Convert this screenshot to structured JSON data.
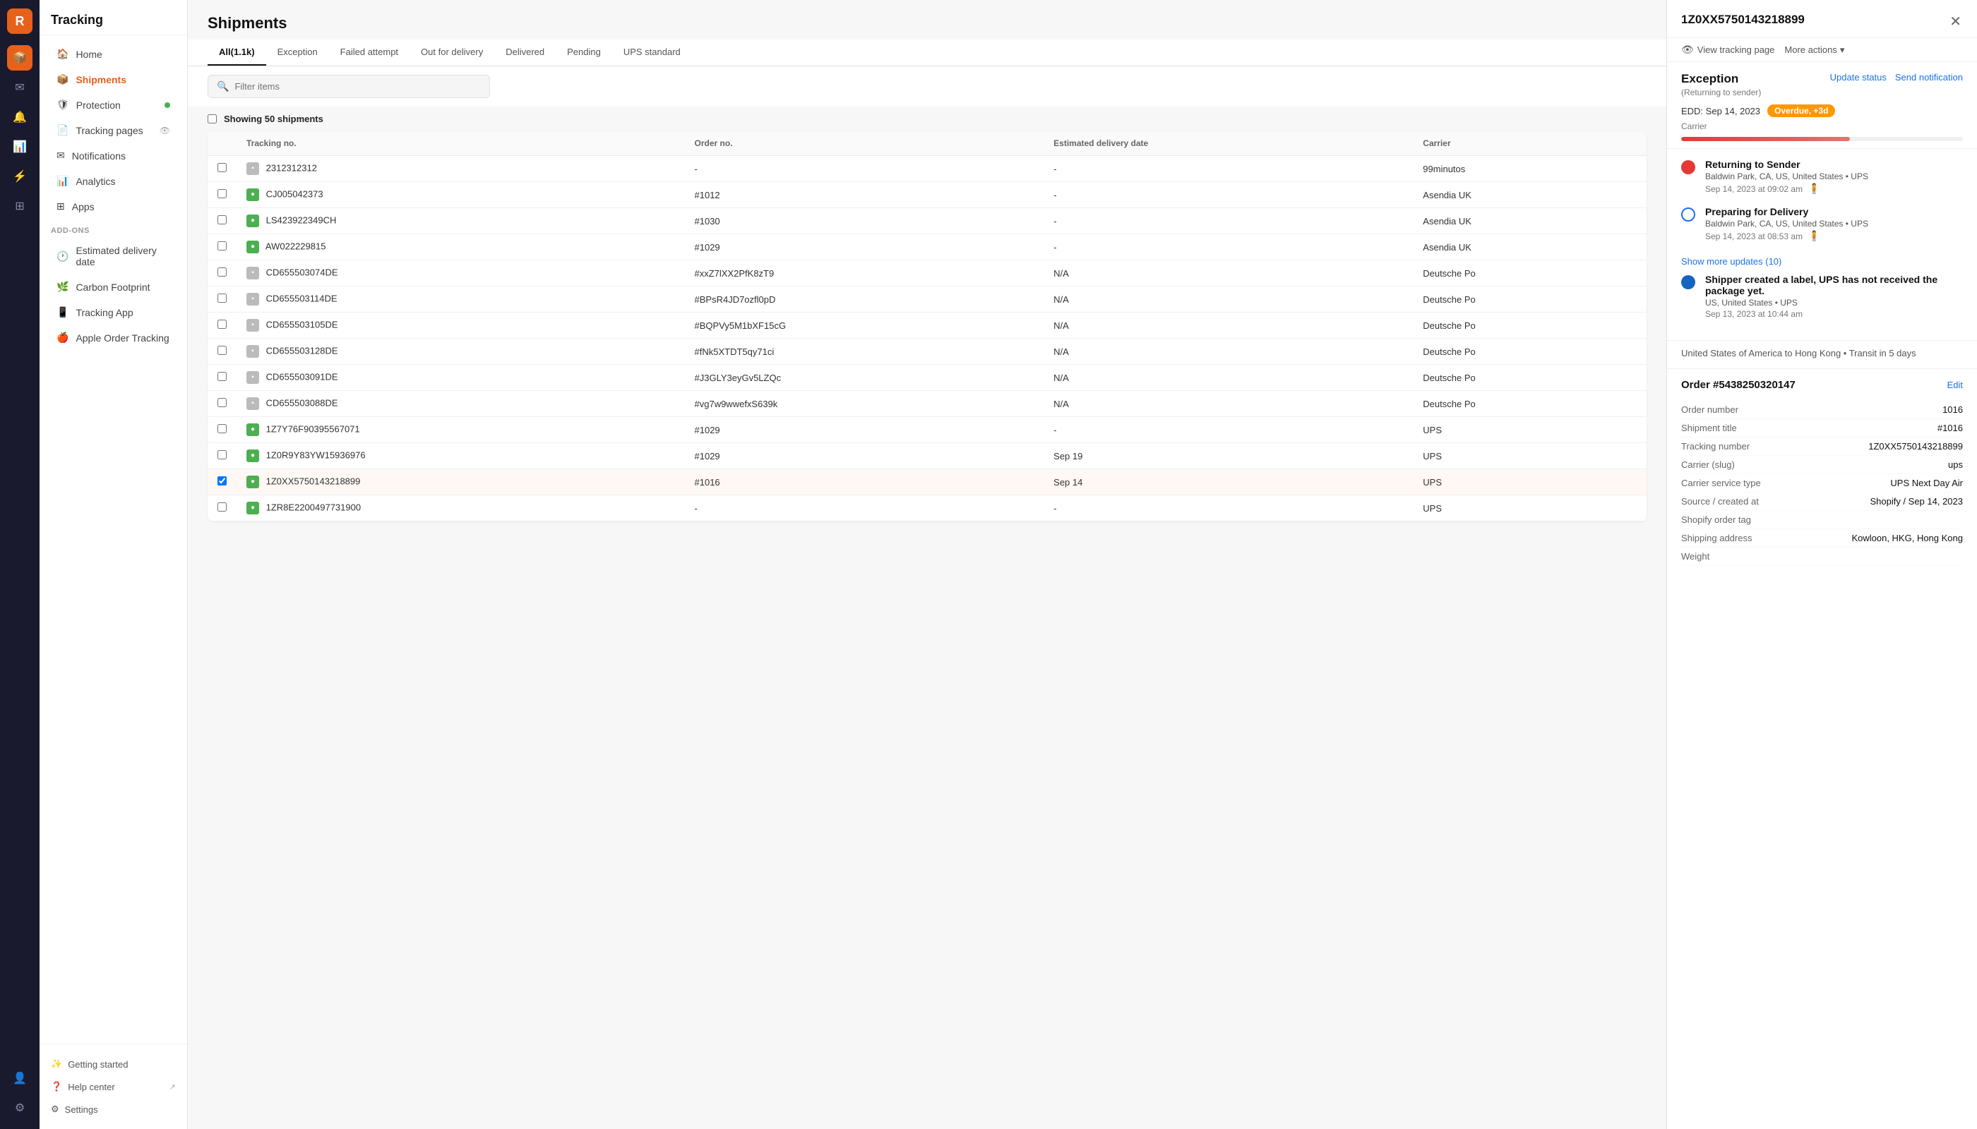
{
  "app": {
    "title": "Tracking",
    "logo_letter": "R"
  },
  "icon_bar": {
    "icons": [
      {
        "name": "grid-icon",
        "symbol": "⊞",
        "active": false
      },
      {
        "name": "track-icon",
        "symbol": "📦",
        "active": true
      },
      {
        "name": "bell-icon",
        "symbol": "🔔",
        "active": false
      },
      {
        "name": "chart-icon",
        "symbol": "📊",
        "active": false
      },
      {
        "name": "mail-icon",
        "symbol": "✉",
        "active": false
      },
      {
        "name": "lightning-icon",
        "symbol": "⚡",
        "active": false
      },
      {
        "name": "apps2-icon",
        "symbol": "⊞",
        "active": false
      },
      {
        "name": "profile-icon",
        "symbol": "👤",
        "active": false
      },
      {
        "name": "settings2-icon",
        "symbol": "⚙",
        "active": false
      }
    ]
  },
  "sidebar": {
    "title": "Tracking",
    "nav_items": [
      {
        "label": "Home",
        "icon": "🏠",
        "active": false,
        "badge": null
      },
      {
        "label": "Shipments",
        "icon": "📦",
        "active": true,
        "badge": null
      },
      {
        "label": "Protection",
        "icon": "🛡",
        "active": false,
        "badge": "dot"
      },
      {
        "label": "Tracking pages",
        "icon": "📄",
        "active": false,
        "badge": "eye"
      },
      {
        "label": "Notifications",
        "icon": "✉",
        "active": false,
        "badge": null
      },
      {
        "label": "Analytics",
        "icon": "📊",
        "active": false,
        "badge": null
      },
      {
        "label": "Apps",
        "icon": "⊞",
        "active": false,
        "badge": null
      }
    ],
    "addons_title": "ADD-ONS",
    "addon_items": [
      {
        "label": "Estimated delivery date",
        "icon": "🕐"
      },
      {
        "label": "Carbon Footprint",
        "icon": "🌿"
      },
      {
        "label": "Tracking App",
        "icon": "📱"
      },
      {
        "label": "Apple Order Tracking",
        "icon": "🍎"
      }
    ],
    "footer_items": [
      {
        "label": "Getting started",
        "icon": "✨",
        "ext": false
      },
      {
        "label": "Help center",
        "icon": "❓",
        "ext": true
      },
      {
        "label": "Settings",
        "icon": "⚙",
        "ext": false
      }
    ]
  },
  "main": {
    "title": "Shipments",
    "tabs": [
      {
        "label": "All(1.1k)",
        "active": true
      },
      {
        "label": "Exception",
        "active": false
      },
      {
        "label": "Failed attempt",
        "active": false
      },
      {
        "label": "Out for delivery",
        "active": false
      },
      {
        "label": "Delivered",
        "active": false
      },
      {
        "label": "Pending",
        "active": false
      },
      {
        "label": "UPS standard",
        "active": false
      }
    ],
    "search_placeholder": "Filter items",
    "showing_label": "Showing 50 shipments",
    "columns": [
      "Tracking no.",
      "Order no.",
      "Estimated delivery date",
      "Carrier"
    ],
    "rows": [
      {
        "tracking": "2312312312",
        "order": "-",
        "edd": "-",
        "carrier": "99minutos",
        "carrier_type": "gray",
        "selected": false
      },
      {
        "tracking": "CJ005042373",
        "order": "#1012",
        "edd": "-",
        "carrier": "Asendia UK",
        "carrier_type": "green",
        "selected": false
      },
      {
        "tracking": "LS423922349CH",
        "order": "#1030",
        "edd": "-",
        "carrier": "Asendia UK",
        "carrier_type": "green",
        "selected": false
      },
      {
        "tracking": "AW022229815",
        "order": "#1029",
        "edd": "-",
        "carrier": "Asendia UK",
        "carrier_type": "green",
        "selected": false
      },
      {
        "tracking": "CD655503074DE",
        "order": "#xxZ7lXX2PfK8zT9",
        "edd": "N/A",
        "carrier": "Deutsche Po",
        "carrier_type": "gray",
        "selected": false
      },
      {
        "tracking": "CD655503114DE",
        "order": "#BPsR4JD7ozfl0pD",
        "edd": "N/A",
        "carrier": "Deutsche Po",
        "carrier_type": "gray",
        "selected": false
      },
      {
        "tracking": "CD655503105DE",
        "order": "#BQPVy5M1bXF15cG",
        "edd": "N/A",
        "carrier": "Deutsche Po",
        "carrier_type": "gray",
        "selected": false
      },
      {
        "tracking": "CD655503128DE",
        "order": "#fNk5XTDT5qy71ci",
        "edd": "N/A",
        "carrier": "Deutsche Po",
        "carrier_type": "gray",
        "selected": false
      },
      {
        "tracking": "CD655503091DE",
        "order": "#J3GLY3eyGv5LZQc",
        "edd": "N/A",
        "carrier": "Deutsche Po",
        "carrier_type": "gray",
        "selected": false
      },
      {
        "tracking": "CD655503088DE",
        "order": "#vg7w9wwefxS639k",
        "edd": "N/A",
        "carrier": "Deutsche Po",
        "carrier_type": "gray",
        "selected": false
      },
      {
        "tracking": "1Z7Y76F90395567071",
        "order": "#1029",
        "edd": "-",
        "carrier": "UPS",
        "carrier_type": "green",
        "selected": false
      },
      {
        "tracking": "1Z0R9Y83YW15936976",
        "order": "#1029",
        "edd": "Sep 19",
        "carrier": "UPS",
        "carrier_type": "green",
        "selected": false
      },
      {
        "tracking": "1Z0XX5750143218899",
        "order": "#1016",
        "edd": "Sep 14",
        "carrier": "UPS",
        "carrier_type": "green",
        "selected": true
      },
      {
        "tracking": "1ZR8E2200497731900",
        "order": "-",
        "edd": "-",
        "carrier": "UPS",
        "carrier_type": "green",
        "selected": false
      }
    ]
  },
  "detail": {
    "tracking_number": "1Z0XX5750143218899",
    "status_title": "Exception",
    "status_sub": "(Returning to sender)",
    "update_status_label": "Update status",
    "send_notification_label": "Send notification",
    "edd_label": "EDD: Sep 14, 2023",
    "overdue_badge": "Overdue, +3d",
    "carrier_label": "Carrier",
    "progress_pct": 60,
    "view_tracking_label": "View tracking page",
    "more_actions_label": "More actions",
    "timeline": [
      {
        "dot_type": "red",
        "title": "Returning to Sender",
        "location": "Baldwin Park, CA, US, United States • UPS",
        "time": "Sep 14, 2023 at 09:02 am",
        "has_person": true
      },
      {
        "dot_type": "blue-outline",
        "title": "Preparing for Delivery",
        "location": "Baldwin Park, CA, US, United States • UPS",
        "time": "Sep 14, 2023 at 08:53 am",
        "has_person": true
      }
    ],
    "show_more_label": "Show more updates (10)",
    "final_timeline": {
      "dot_type": "blue-filled",
      "title": "Shipper created a label, UPS has not received the package yet.",
      "location": "US, United States • UPS",
      "time": "Sep 13, 2023 at 10:44 am",
      "has_person": false
    },
    "transit_info": "United States of America to Hong Kong • Transit in 5 days",
    "order": {
      "title": "Order #5438250320147",
      "edit_label": "Edit",
      "fields": [
        {
          "label": "Order number",
          "value": "1016"
        },
        {
          "label": "Shipment title",
          "value": "#1016"
        },
        {
          "label": "Tracking number",
          "value": "1Z0XX5750143218899"
        },
        {
          "label": "Carrier (slug)",
          "value": "ups"
        },
        {
          "label": "Carrier service type",
          "value": "UPS Next Day Air"
        },
        {
          "label": "Source / created at",
          "value": "Shopify / Sep 14, 2023"
        },
        {
          "label": "Shopify order tag",
          "value": ""
        },
        {
          "label": "Shipping address",
          "value": "Kowloon, HKG, Hong Kong"
        },
        {
          "label": "Weight",
          "value": ""
        }
      ]
    }
  }
}
